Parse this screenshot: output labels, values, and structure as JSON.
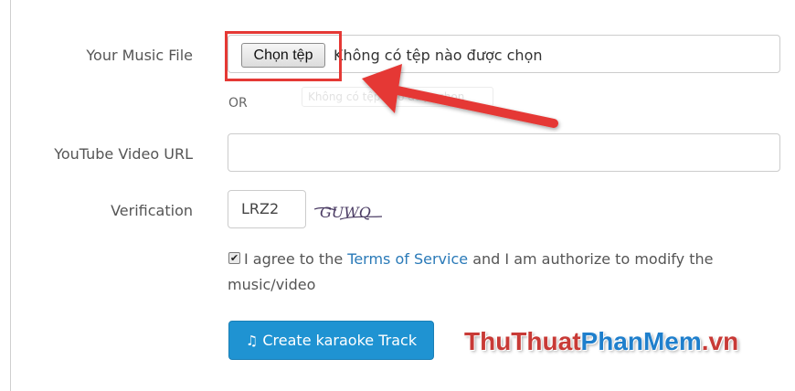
{
  "form": {
    "music_file_label": "Your Music File",
    "choose_file_button": "Chọn tệp",
    "no_file_text": "Không có tệp nào được chọn",
    "or_text": "OR",
    "youtube_label": "YouTube Video URL",
    "youtube_value": "",
    "verification_label": "Verification",
    "verification_value": "LRZ2",
    "captcha_text": "GUWQ",
    "agree_prefix": "I agree to the ",
    "terms_link": "Terms of Service",
    "agree_suffix": " and I am authorize to modify the music/video",
    "agree_checked": true,
    "create_button": "Create karaoke Track"
  },
  "watermark": {
    "part1": "ThuThuat",
    "part2": "PhanMem",
    "part3": ".vn"
  },
  "colors": {
    "highlight": "#e53935",
    "primary_button": "#1f93d2",
    "link": "#2a7ab8",
    "watermark_red": "#c83a36",
    "watermark_blue": "#1f7fcc"
  },
  "icons": {
    "create_button_icon": "music-note-icon",
    "annotation": "red-arrow-icon"
  }
}
